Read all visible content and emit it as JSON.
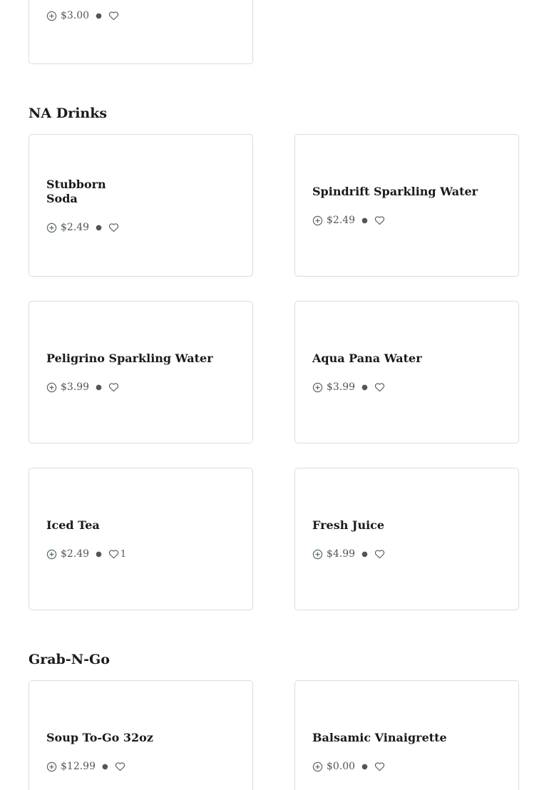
{
  "sections": [
    {
      "title": "",
      "items": [
        {
          "name": "",
          "price": "$3.00",
          "likes": ""
        }
      ]
    },
    {
      "title": "NA Drinks",
      "items": [
        {
          "name": "Stubborn Soda",
          "price": "$2.49",
          "likes": ""
        },
        {
          "name": "Spindrift Sparkling Water",
          "price": "$2.49",
          "likes": ""
        },
        {
          "name": "Peligrino Sparkling Water",
          "price": "$3.99",
          "likes": ""
        },
        {
          "name": "Aqua Pana Water",
          "price": "$3.99",
          "likes": ""
        },
        {
          "name": "Iced Tea",
          "price": "$2.49",
          "likes": "1"
        },
        {
          "name": "Fresh Juice",
          "price": "$4.99",
          "likes": ""
        }
      ]
    },
    {
      "title": "Grab-N-Go",
      "items": [
        {
          "name": "Soup To-Go 32oz",
          "price": "$12.99",
          "likes": ""
        },
        {
          "name": "Balsamic Vinaigrette",
          "price": "$0.00",
          "likes": ""
        }
      ]
    }
  ],
  "icons": {
    "add": "add-circle-icon",
    "like": "heart-icon"
  },
  "colors": {
    "icon": "#5a6b62",
    "border": "#dcdcdc",
    "text": "#1a1a1a"
  }
}
